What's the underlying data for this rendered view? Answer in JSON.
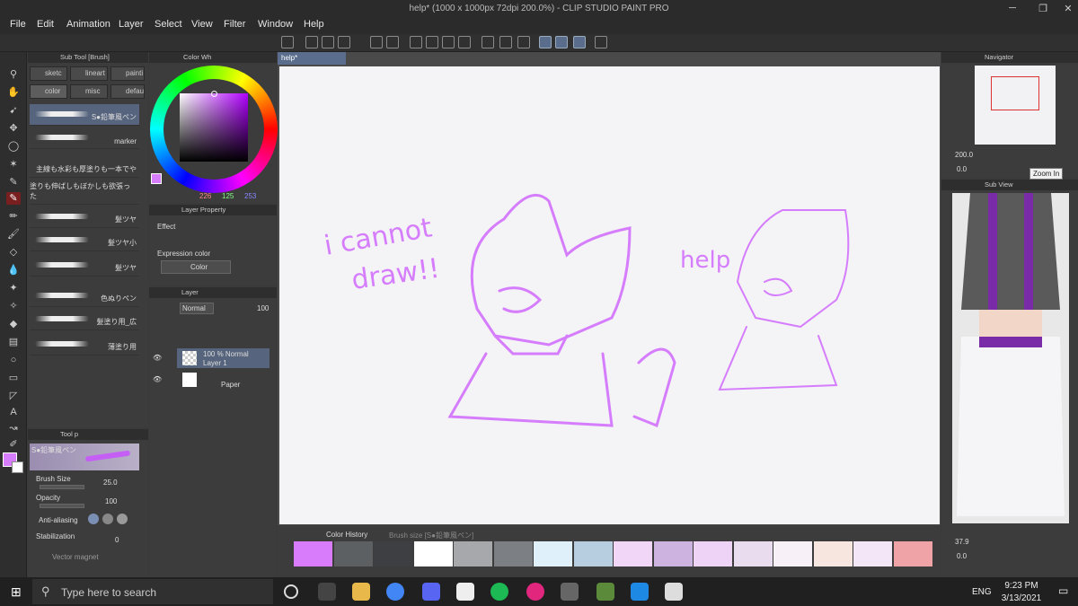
{
  "window": {
    "title": "help* (1000 x 1000px 72dpi 200.0%) - CLIP STUDIO PAINT PRO"
  },
  "menu": [
    "File",
    "Edit",
    "Animation",
    "Layer",
    "Select",
    "View",
    "Filter",
    "Window",
    "Help"
  ],
  "subtool": {
    "title": "Sub Tool [Brush]",
    "tabs": [
      "sketc",
      "lineart",
      "painti",
      "color",
      "misc",
      "defau"
    ],
    "brushes": [
      "S●鉛筆風ペン",
      "marker",
      "主線も水彩も厚塗りも一本でや",
      "塗りも伸ばしもぼかしも欲張った",
      "髪ツヤ",
      "髪ツヤ小",
      "髪ツヤ",
      "色ぬりペン",
      "髪塗り用_広",
      "薄塗り用"
    ]
  },
  "toolprop": {
    "title": "Tool p",
    "brush_name": "S●鉛筆風ペン",
    "brush_size_label": "Brush Size",
    "brush_size": "25.0",
    "opacity_label": "Opacity",
    "opacity": "100",
    "antialias_label": "Anti-aliasing",
    "stabilization_label": "Stabilization",
    "stabilization": "0",
    "vector_magnet_label": "Vector magnet"
  },
  "color": {
    "tab": "Color Wh",
    "r": "226",
    "g": "125",
    "b": "253",
    "main": "#d57dfd"
  },
  "layerprop": {
    "title": "Layer Property",
    "effect": "Effect",
    "expr_label": "Expression color",
    "expr_value": "Color"
  },
  "layers": {
    "title": "Layer",
    "blend": "Normal",
    "opacity": "100",
    "items": [
      {
        "line1": "100 % Normal",
        "line2": "Layer 1"
      },
      {
        "line1": "",
        "line2": "Paper"
      }
    ]
  },
  "doc": {
    "tab": "help*"
  },
  "canvas_text": [
    "i cannot",
    "draw!!",
    "help"
  ],
  "history": {
    "tab": "Color History",
    "tab2": "Brush size [S●鉛筆風ペン]",
    "swatches": [
      "#d87cfb",
      "#5c6062",
      "#3e3f42",
      "#ffffff",
      "#a6a8ac",
      "#7c7f83",
      "#dff0fa",
      "#b7cde0",
      "#f2d6f8",
      "#ccb3e0",
      "#efd3f7",
      "#eadcef",
      "#f7f0f7",
      "#f7e6e0",
      "#f2e6f7",
      "#f0a3a6"
    ]
  },
  "navigator": {
    "title": "Navigator",
    "zoom": "200.0",
    "rotate": "0.0",
    "tooltip": "Zoom In"
  },
  "subview": {
    "title": "Sub View",
    "zoom": "37.9",
    "rotate": "0.0"
  },
  "taskbar": {
    "search": "Type here to search",
    "time": "9:23 PM",
    "date": "3/13/2021",
    "lang": "ENG"
  }
}
